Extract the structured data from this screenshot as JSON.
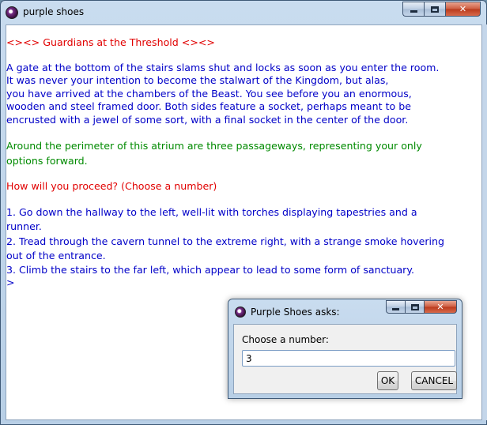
{
  "window": {
    "title": "purple shoes",
    "controls": [
      "minimize",
      "maximize",
      "close"
    ]
  },
  "story": {
    "heading": "<><> Guardians at the Threshold <><>",
    "description": "A gate at the bottom of the stairs slams shut and locks as soon as you enter the room. It was never your intention to become the stalwart of the Kingdom, but alas, you have arrived at the chambers of the Beast.  You see before you an enormous, wooden and steel framed door.  Both sides feature a socket, perhaps meant to be encrusted with a jewel of some sort, with a final socket in the center of the door.",
    "description_lines": [
      "A gate at the bottom of the stairs slams shut and locks as soon as you enter the room.",
      "It was never your intention to become the stalwart of the Kingdom, but alas,",
      "you have arrived at the chambers of the Beast.  You see before you an enormous,",
      "wooden and steel framed door.  Both sides feature a socket, perhaps meant to be",
      "encrusted with a jewel of some sort, with a final socket in the center of the door."
    ],
    "perimeter_lines": [
      "Around the perimeter of this atrium are three passageways, representing your only",
      "options forward."
    ],
    "prompt": "How will you proceed? (Choose a number)",
    "options": [
      {
        "line1": "1. Go down the hallway to the left, well-lit with torches displaying tapestries and a",
        "line2": "runner."
      },
      {
        "line1": "2. Tread through the cavern tunnel to the extreme right, with a strange smoke hovering",
        "line2": "out of the entrance."
      },
      {
        "line1": "3. Climb the stairs to the far left, which appear to lead to some form of sanctuary.",
        "line2": ""
      }
    ],
    "cursor": ">"
  },
  "dialog": {
    "title": "Purple Shoes asks:",
    "label": "Choose a number:",
    "input_value": "3",
    "ok_label": "OK",
    "cancel_label": "CANCEL"
  },
  "colors": {
    "heading": "#e10000",
    "description": "#0000c8",
    "perimeter": "#008a00",
    "prompt": "#e10000",
    "options": "#0000c8"
  }
}
